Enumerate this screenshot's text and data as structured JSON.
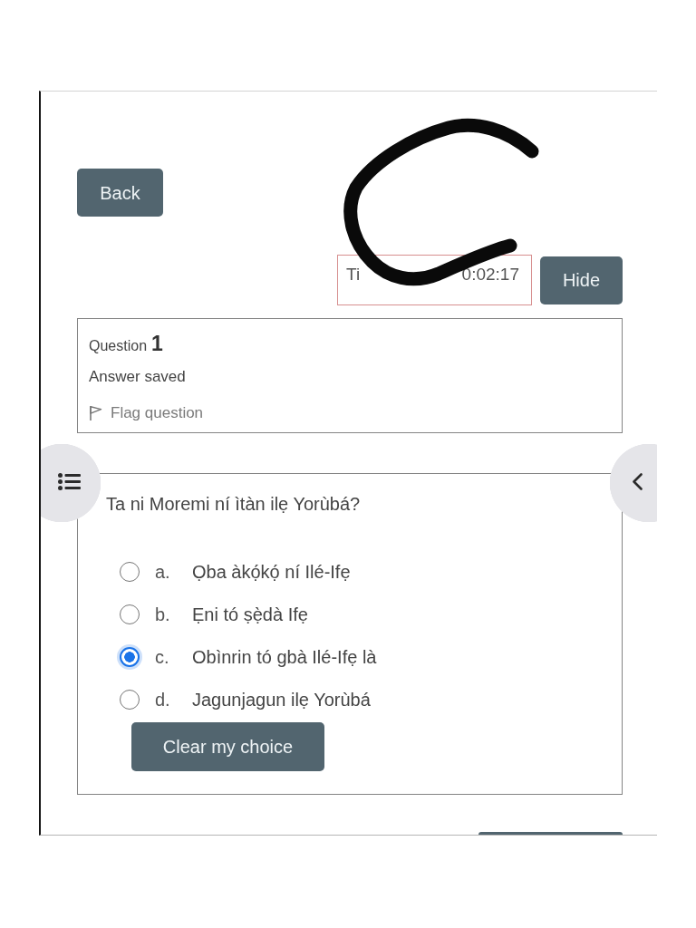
{
  "navigation": {
    "back_button": "Back"
  },
  "timer": {
    "visible_start": "Ti",
    "visible_end": "0:02:17",
    "hide_button": "Hide"
  },
  "overlay_mark": {
    "kind": "scribble"
  },
  "question_info": {
    "label": "Question",
    "number": "1",
    "status": "Answer saved",
    "flag": {
      "label": "Flag question",
      "flagged": false
    }
  },
  "question": {
    "text": "Ta ni Moremi ní ìtàn ilẹ Yorùbá?",
    "options": [
      {
        "letter": "a.",
        "text": "Ọba àkọ́kọ́ ní Ilé-Ifẹ",
        "selected": false
      },
      {
        "letter": "b.",
        "text": "Ẹni tó ṣẹ̀dà Ifẹ",
        "selected": false
      },
      {
        "letter": "c.",
        "text": "Obìnrin tó gbà Ilé-Ifẹ là",
        "selected": true
      },
      {
        "letter": "d.",
        "text": "Jagunjagun ilẹ Yorùbá",
        "selected": false
      }
    ],
    "clear_button": "Clear my choice"
  },
  "bottom_button": {
    "kind": "cut_off"
  }
}
